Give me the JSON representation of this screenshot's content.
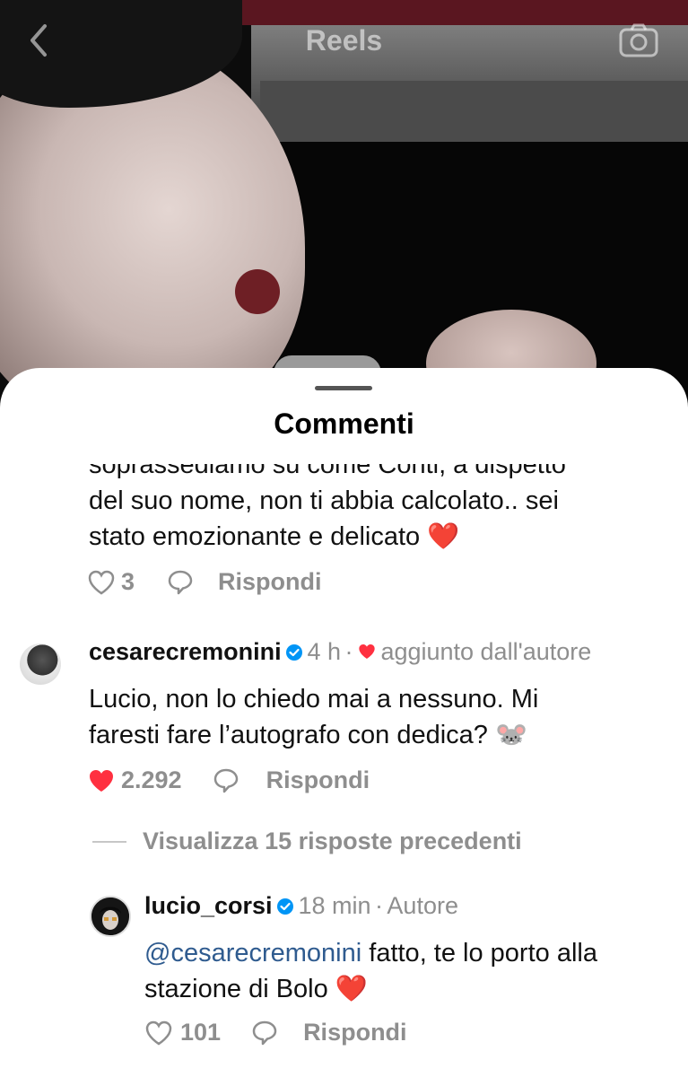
{
  "nav": {
    "back_icon": "chevron-left-icon",
    "title": "Reels",
    "camera_icon": "camera-icon"
  },
  "sheet": {
    "title": "Commenti"
  },
  "comments": [
    {
      "text_line1": "soprassediamo su come Conti, a dispetto",
      "text_line2": "del suo nome, non ti abbia calcolato.. sei",
      "text_line3": "stato emozionante e delicato",
      "emoji": "❤️",
      "likes": "3",
      "reply": "Rispondi"
    },
    {
      "username": "cesarecremonini",
      "time": "4 h",
      "separator": "·",
      "author_badge": "aggiunto dall'autore",
      "text_line1": "Lucio, non lo chiedo mai a nessuno. Mi",
      "text_line2": "faresti fare l’autografo con dedica?",
      "emoji": "🐭",
      "likes": "2.292",
      "reply": "Rispondi",
      "view_replies": "Visualizza 15 risposte precedenti"
    },
    {
      "username": "lucio_corsi",
      "time": "18 min",
      "separator": "·",
      "tag": "Autore",
      "mention": "@cesarecremonini",
      "text_line1_rest": " fatto, te lo porto alla",
      "text_line2": "stazione di Bolo",
      "emoji": "❤️",
      "likes": "101",
      "reply": "Rispondi"
    }
  ],
  "colors": {
    "like_red": "#ff3040",
    "verified_blue": "#0095f6",
    "gray": "#8e8e8e",
    "mention": "#2f5b8f"
  }
}
